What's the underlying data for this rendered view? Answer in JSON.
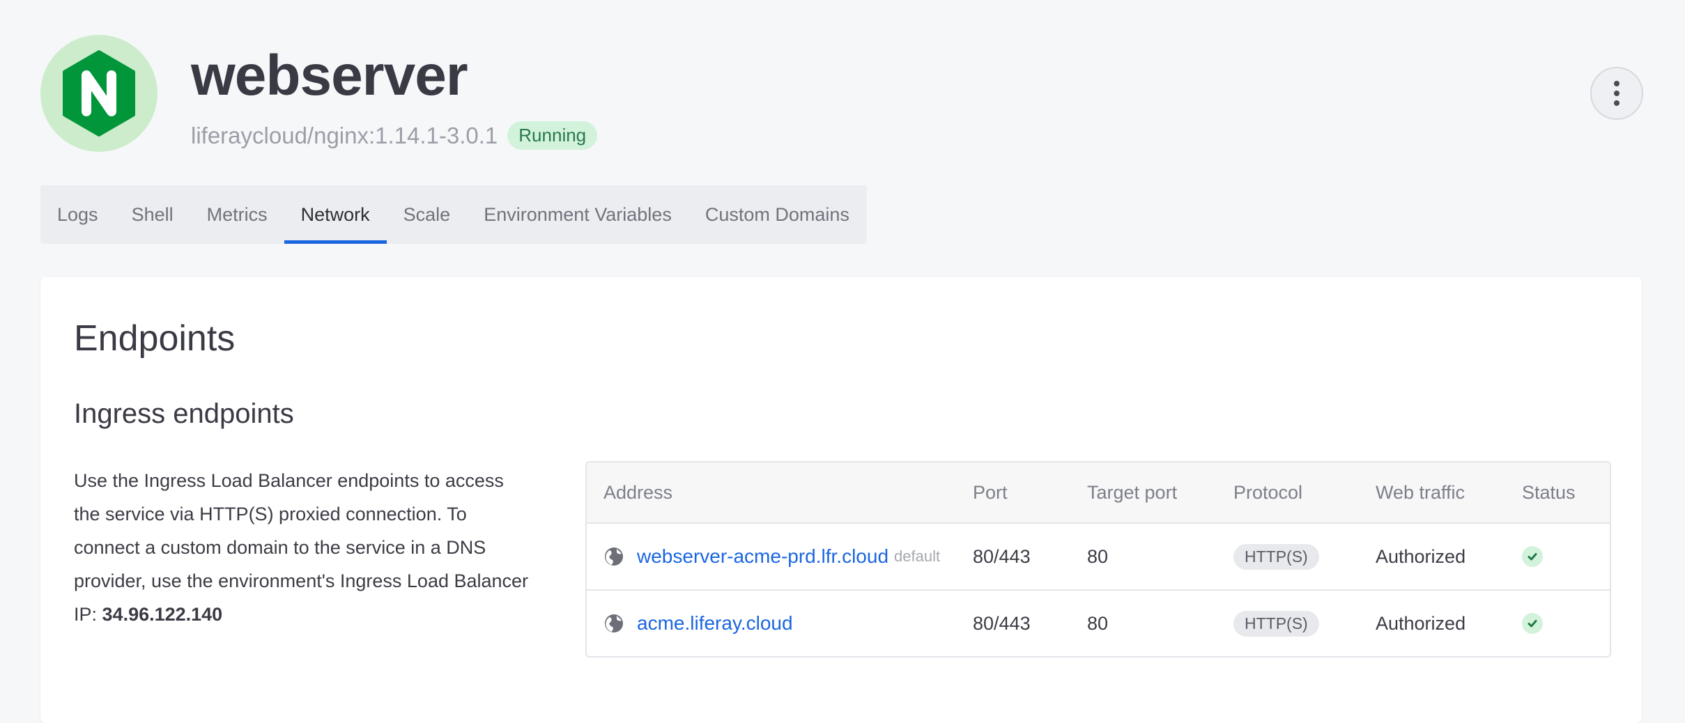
{
  "service": {
    "name": "webserver",
    "image": "liferaycloud/nginx:1.14.1-3.0.1",
    "status": "Running",
    "logo_icon": "nginx-logo",
    "brand_color": "#009639"
  },
  "tabs": [
    {
      "label": "Logs",
      "active": false
    },
    {
      "label": "Shell",
      "active": false
    },
    {
      "label": "Metrics",
      "active": false
    },
    {
      "label": "Network",
      "active": true
    },
    {
      "label": "Scale",
      "active": false
    },
    {
      "label": "Environment Variables",
      "active": false
    },
    {
      "label": "Custom Domains",
      "active": false
    }
  ],
  "main": {
    "title": "Endpoints",
    "section_title": "Ingress endpoints",
    "description": "Use the Ingress Load Balancer endpoints to access the service via HTTP(S) proxied connection. To connect a custom domain to the service in a DNS provider, use the environment's Ingress Load Balancer IP:",
    "ip": "34.96.122.140"
  },
  "table": {
    "headers": [
      "Address",
      "Port",
      "Target port",
      "Protocol",
      "Web traffic",
      "Status"
    ],
    "rows": [
      {
        "address": "webserver-acme-prd.lfr.cloud",
        "tag": "default",
        "port": "80/443",
        "target_port": "80",
        "protocol": "HTTP(S)",
        "web_traffic": "Authorized",
        "status_icon": "check-icon"
      },
      {
        "address": "acme.liferay.cloud",
        "tag": "",
        "port": "80/443",
        "target_port": "80",
        "protocol": "HTTP(S)",
        "web_traffic": "Authorized",
        "status_icon": "check-icon"
      }
    ]
  },
  "colors": {
    "accent": "#1a66e0",
    "running_bg": "#d3f2dc",
    "running_text": "#26794a"
  }
}
